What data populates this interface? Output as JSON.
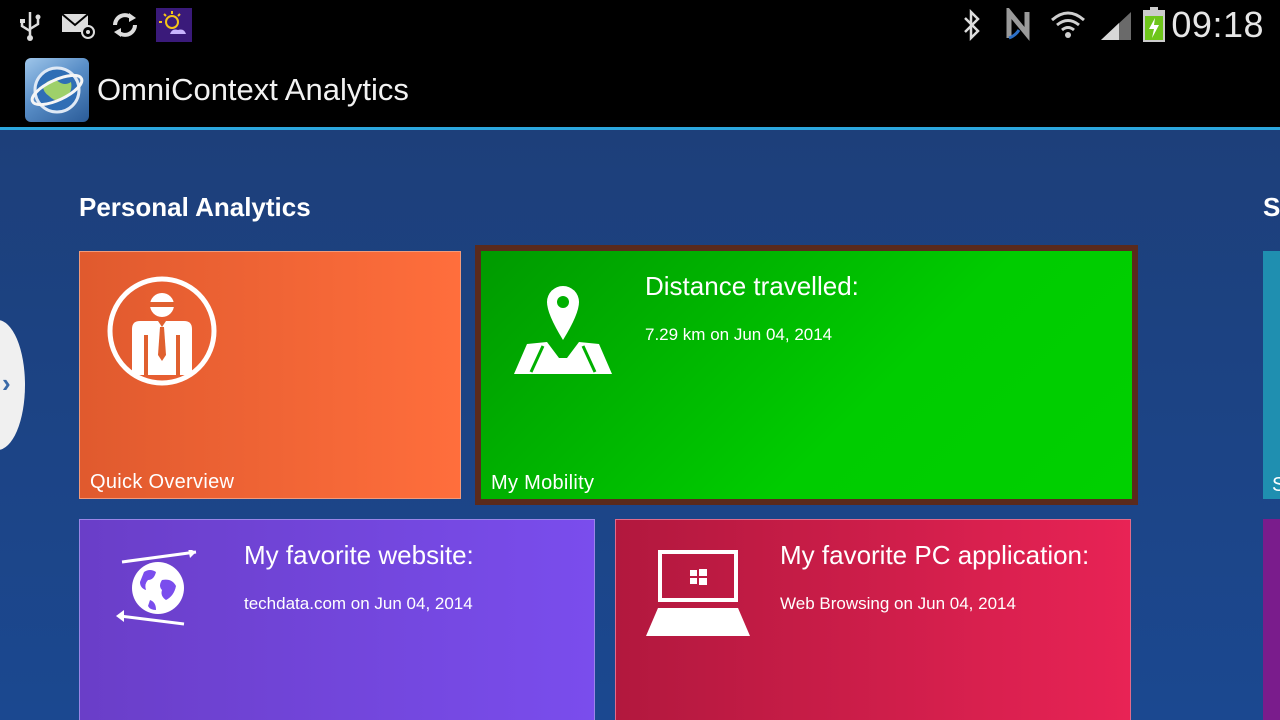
{
  "status_bar": {
    "time": "09:18",
    "icons": [
      "usb-icon",
      "email-icon",
      "sync-icon",
      "weather-icon",
      "bluetooth-icon",
      "nfc-icon",
      "wifi-icon",
      "signal-icon",
      "battery-icon"
    ]
  },
  "app_bar": {
    "title": "OmniContext Analytics"
  },
  "sections": {
    "personal_title": "Personal Analytics",
    "second_title_peek": "S"
  },
  "tiles": {
    "quick_overview": {
      "label": "Quick Overview"
    },
    "mobility": {
      "label": "My Mobility",
      "heading": "Distance travelled:",
      "detail": "7.29 km on Jun 04, 2014"
    },
    "website": {
      "heading": "My favorite website:",
      "detail": "techdata.com on Jun 04, 2014"
    },
    "pc_app": {
      "heading": "My favorite PC application:",
      "detail": "Web Browsing on Jun 04, 2014"
    },
    "right_peek_label": "S"
  },
  "colors": {
    "accent": "#2ca7de",
    "overview_tile": "#ff6e3c",
    "mobility_tile": "#00cc00",
    "website_tile": "#7a4ded",
    "pc_app_tile": "#e82355"
  }
}
